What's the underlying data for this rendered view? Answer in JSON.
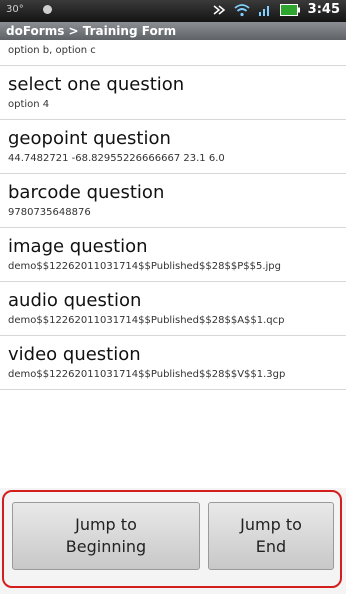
{
  "status_bar": {
    "temperature": "30°",
    "time": "3:45",
    "icons": [
      "notification-icon",
      "signal-icon",
      "wifi-icon",
      "cell-bars-icon",
      "battery-icon"
    ]
  },
  "header": {
    "title": "doForms > Training Form"
  },
  "items": [
    {
      "question": "",
      "answer": "option b, option c"
    },
    {
      "question": "select one question",
      "answer": "option 4"
    },
    {
      "question": "geopoint question",
      "answer": "44.7482721 -68.82955226666667 23.1 6.0"
    },
    {
      "question": "barcode question",
      "answer": "9780735648876"
    },
    {
      "question": "image question",
      "answer": "demo$$12262011031714$$Published$$28$$P$$5.jpg"
    },
    {
      "question": "audio question",
      "answer": "demo$$12262011031714$$Published$$28$$A$$1.qcp"
    },
    {
      "question": "video question",
      "answer": "demo$$12262011031714$$Published$$28$$V$$1.3gp"
    }
  ],
  "buttons": {
    "jump_beginning": "Jump to\nBeginning",
    "jump_end": "Jump to\nEnd"
  },
  "colors": {
    "highlight": "#d41d1d",
    "title_bar": "#5e6266"
  }
}
